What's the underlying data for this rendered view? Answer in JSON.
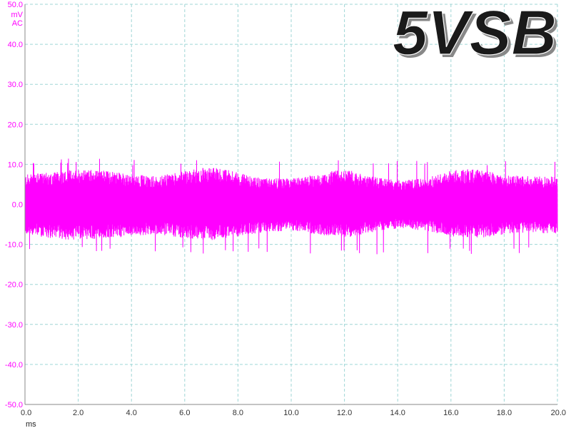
{
  "chart_data": {
    "type": "line",
    "badge": "5VSB",
    "y_unit": "mV",
    "y_coupling": "AC",
    "x_unit": "ms",
    "xlim": [
      0.0,
      20.0
    ],
    "ylim": [
      -50.0,
      50.0
    ],
    "x_ticks": [
      "0.0",
      "2.0",
      "4.0",
      "6.0",
      "8.0",
      "10.0",
      "12.0",
      "14.0",
      "16.0",
      "18.0",
      "20.0"
    ],
    "y_ticks": [
      "50.0",
      "40.0",
      "30.0",
      "20.0",
      "10.0",
      "0.0",
      "-10.0",
      "-20.0",
      "-30.0",
      "-40.0",
      "-50.0"
    ],
    "grid": true,
    "series": [
      {
        "color": "#ff00ff",
        "description": "AC ripple/noise, approx ±7 mV envelope with peaks to about ±12 mV",
        "envelope_x": [
          0.0,
          1.0,
          2.0,
          3.0,
          4.0,
          5.0,
          6.0,
          7.0,
          8.0,
          9.0,
          10.0,
          11.0,
          12.0,
          13.0,
          14.0,
          15.0,
          16.0,
          17.0,
          18.0,
          19.0,
          20.0
        ],
        "envelope_upper": [
          7.5,
          8.0,
          9.0,
          8.5,
          7.5,
          7.0,
          8.5,
          9.5,
          8.0,
          6.5,
          6.5,
          7.5,
          9.0,
          7.0,
          6.0,
          6.5,
          8.5,
          9.0,
          7.5,
          7.0,
          7.0
        ],
        "envelope_lower": [
          -7.5,
          -8.5,
          -9.0,
          -8.5,
          -8.0,
          -7.5,
          -8.5,
          -9.0,
          -8.0,
          -7.0,
          -6.5,
          -7.5,
          -8.5,
          -7.0,
          -6.0,
          -6.5,
          -8.0,
          -8.5,
          -7.5,
          -7.0,
          -7.5
        ],
        "peak_max": 11.5,
        "peak_min": -12.5
      }
    ],
    "colors": {
      "grid": "#9fd6d6",
      "axis": "#888888",
      "trace": "#ff00ff",
      "y_label": "#ff00ff",
      "x_label": "#333333"
    }
  }
}
